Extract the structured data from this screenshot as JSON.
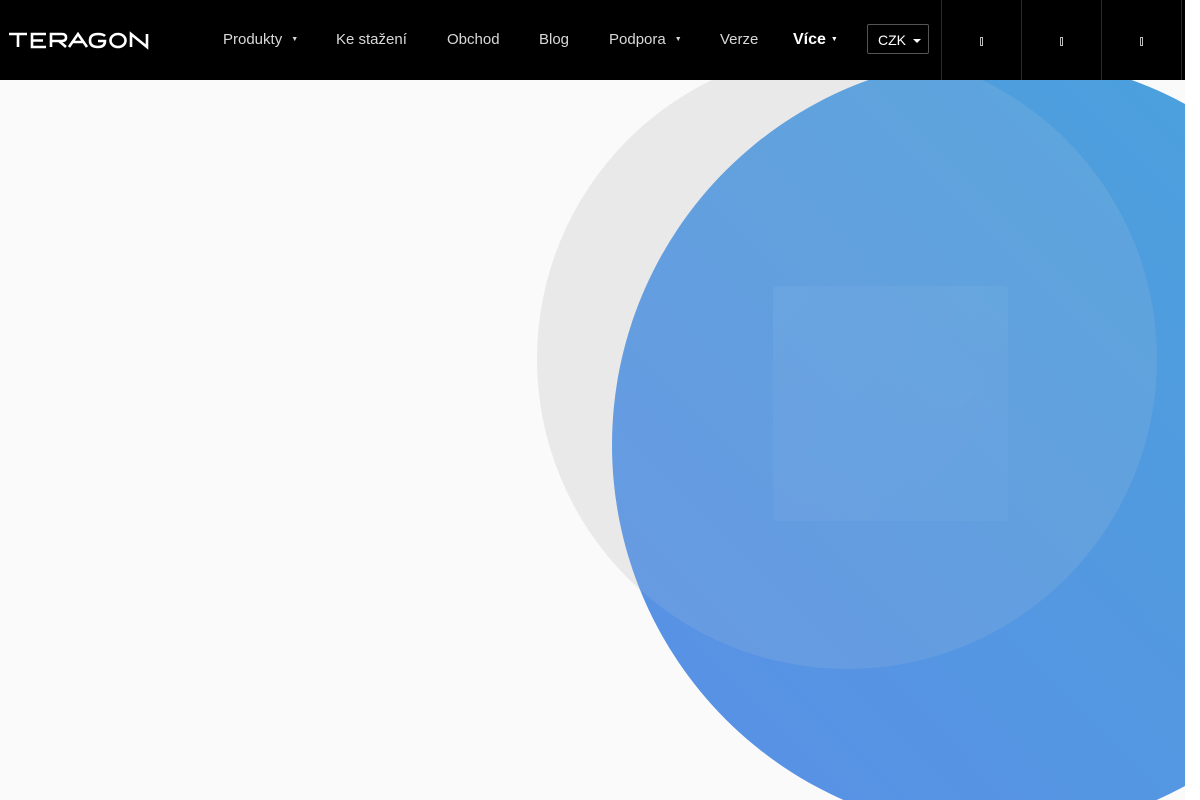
{
  "brand": {
    "logo_text": "TERAGON"
  },
  "nav": {
    "items": [
      {
        "label": "Produkty",
        "has_dropdown": true
      },
      {
        "label": "Ke stažení",
        "has_dropdown": false
      },
      {
        "label": "Obchod",
        "has_dropdown": false
      },
      {
        "label": "Blog",
        "has_dropdown": false
      },
      {
        "label": "Podpora",
        "has_dropdown": true
      },
      {
        "label": "Verze",
        "has_dropdown": false
      },
      {
        "label": "Více",
        "has_dropdown": true
      }
    ],
    "caret_glyph": "▼"
  },
  "currency": {
    "selected": "CZK"
  },
  "icons": [
    {
      "name": "search-icon"
    },
    {
      "name": "user-icon"
    },
    {
      "name": "cart-icon"
    }
  ],
  "colors": {
    "navbar_bg": "#000000",
    "page_bg": "#fafafa",
    "gray_circle": "#ececec",
    "gradient_start": "#5b8fe6",
    "gradient_end": "#49a3db"
  }
}
